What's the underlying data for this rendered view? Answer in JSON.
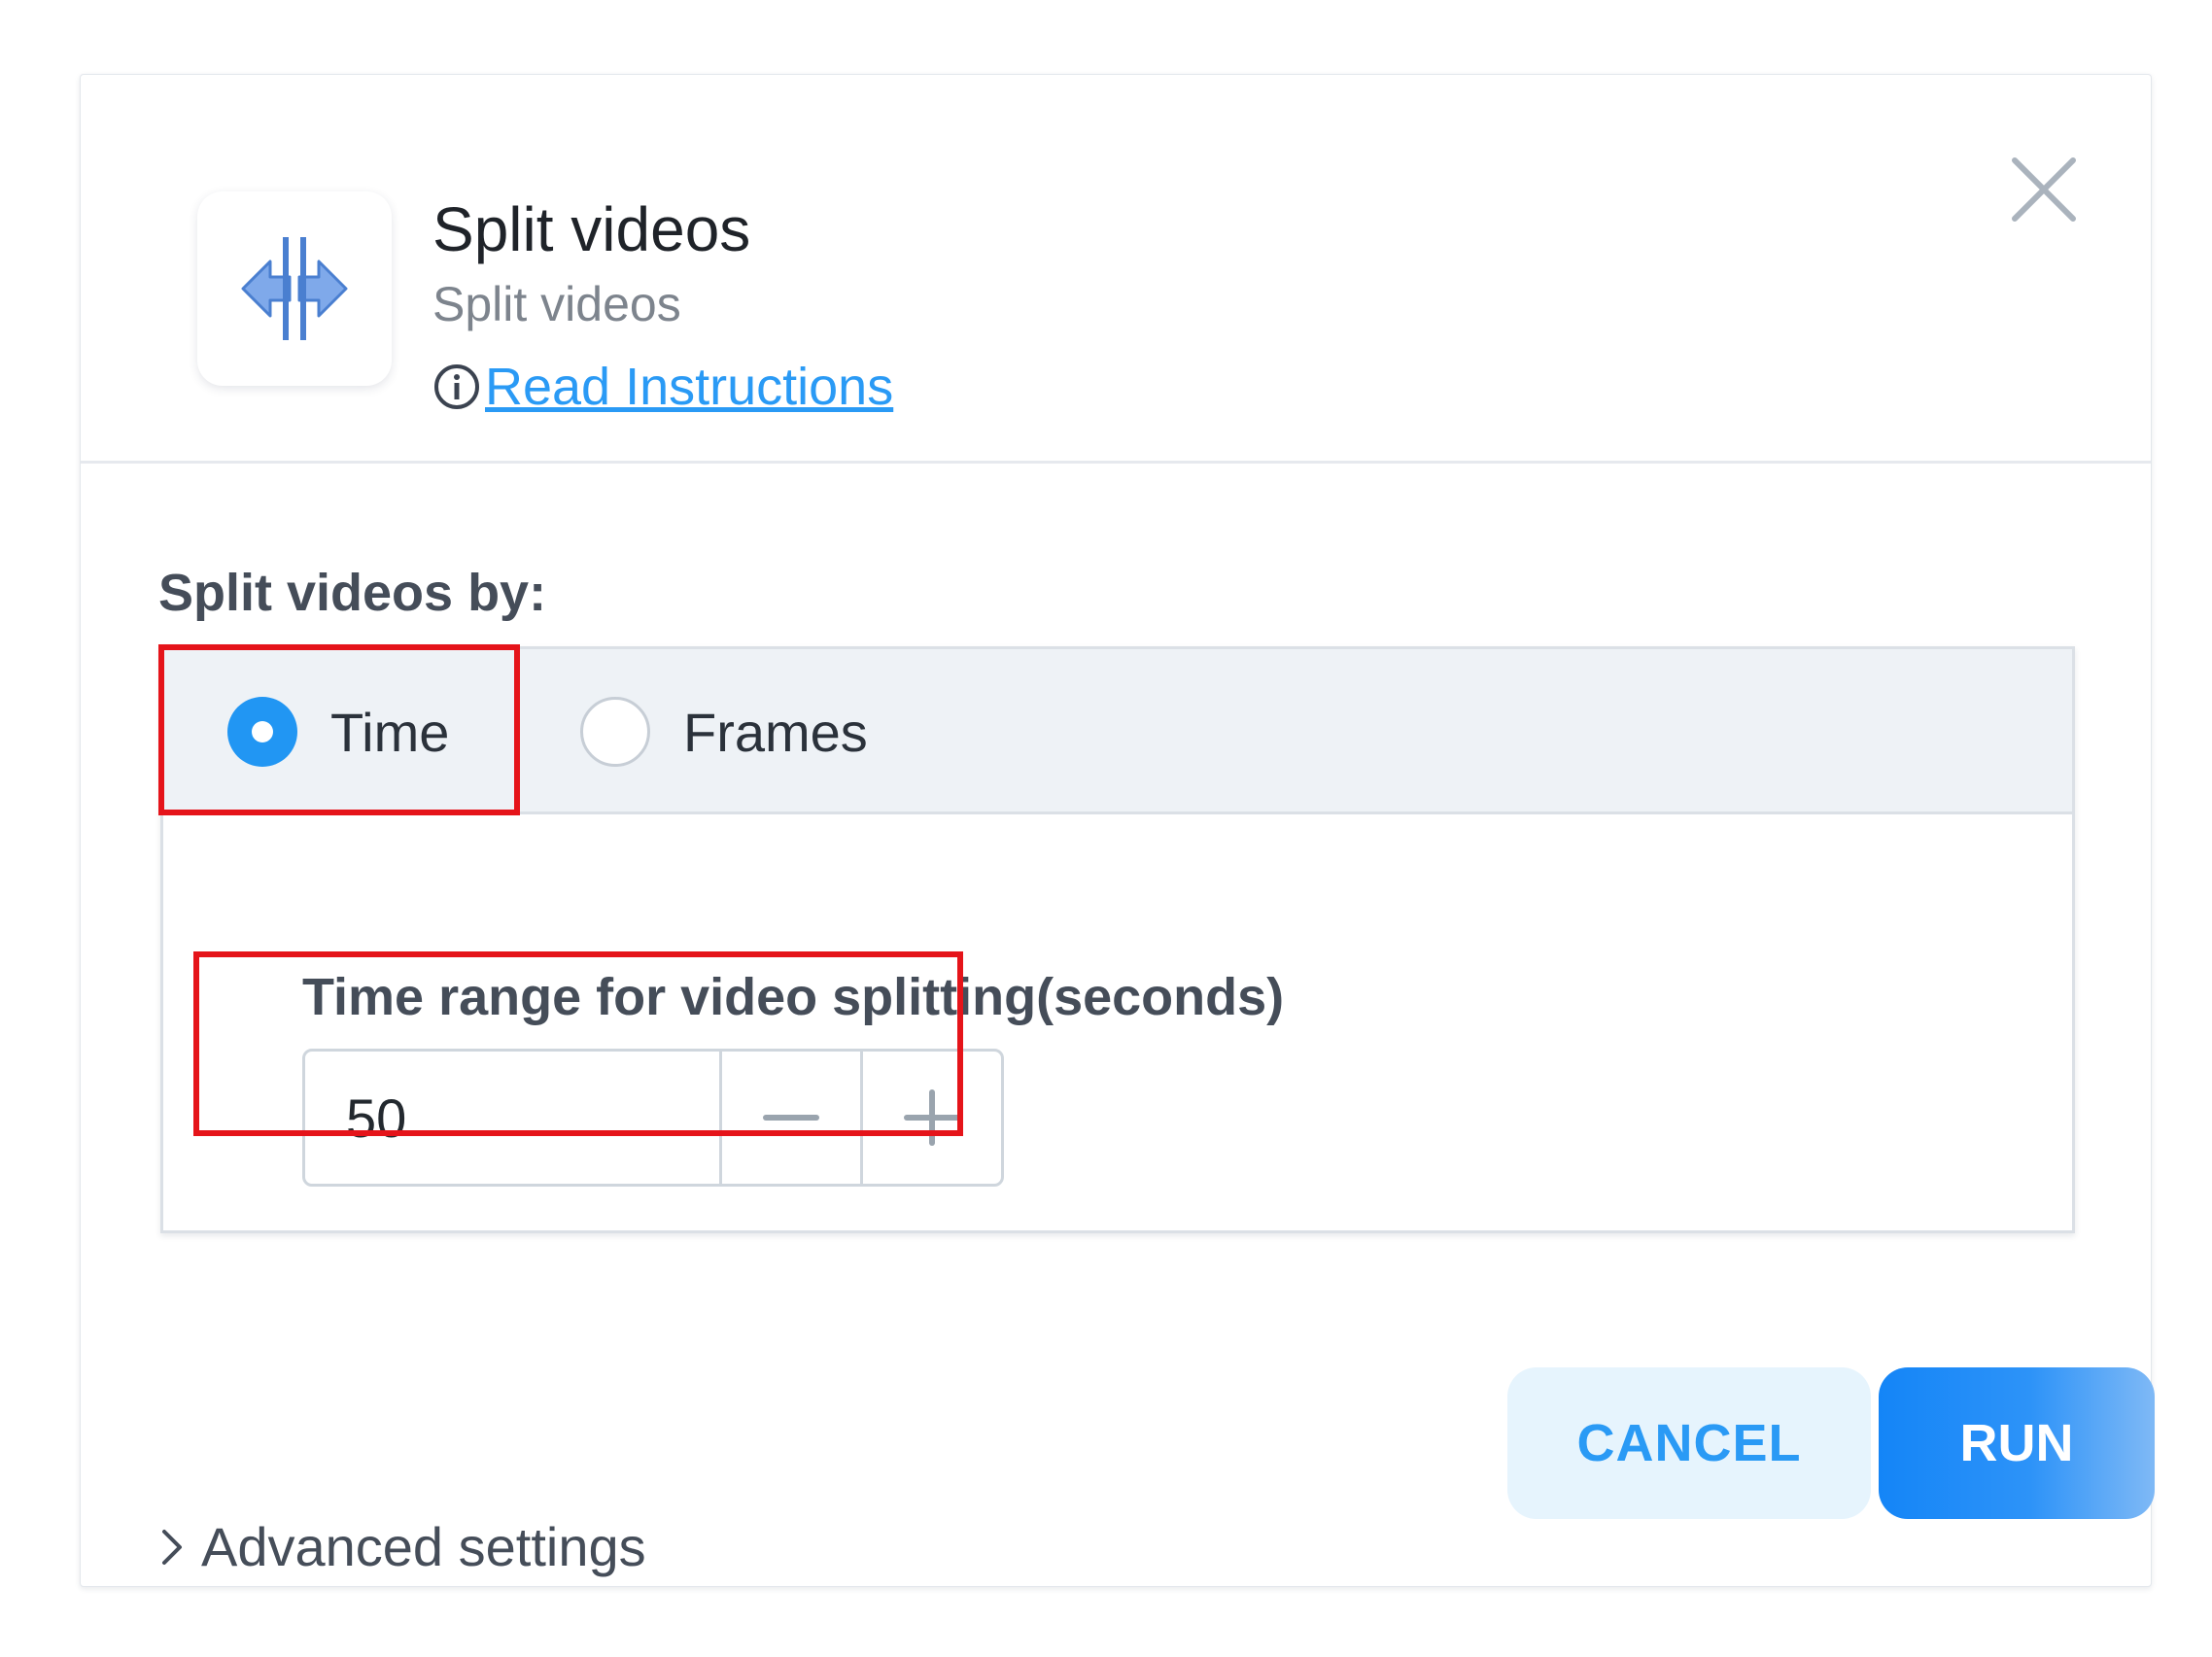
{
  "header": {
    "title": "Split videos",
    "subtitle": "Split videos",
    "read_instructions": "Read Instructions",
    "app_icon": "split-arrows-icon",
    "info_icon": "info-icon",
    "close_icon": "close-icon"
  },
  "split_by": {
    "label": "Split videos by:",
    "options": [
      {
        "label": "Time",
        "selected": true
      },
      {
        "label": "Frames",
        "selected": false
      }
    ]
  },
  "time_range": {
    "label": "Time range for video splitting(seconds)",
    "value": "50",
    "decrement_icon": "minus-icon",
    "increment_icon": "plus-icon"
  },
  "actions": {
    "cancel_label": "CANCEL",
    "run_label": "RUN"
  },
  "advanced": {
    "label": "Advanced settings",
    "icon": "chevron-right-icon"
  },
  "colors": {
    "accent": "#2196f3",
    "link": "#2a9af5",
    "highlight": "#e5141a",
    "cancel_bg": "#e6f4fd"
  }
}
